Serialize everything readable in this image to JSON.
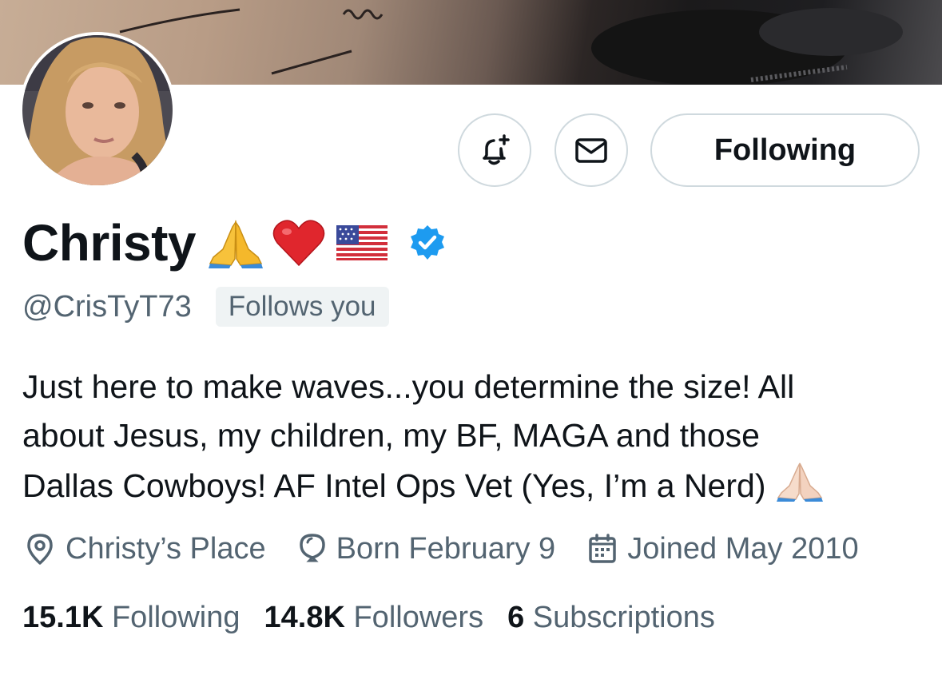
{
  "profile": {
    "name": "Christy",
    "name_emojis": [
      "praying-hands",
      "red-heart",
      "us-flag"
    ],
    "handle": "@CrisTyT73",
    "follows_you_label": "Follows you",
    "verified": true
  },
  "actions": {
    "following_label": "Following"
  },
  "bio": {
    "lines": [
      "Just here to make waves...you determine the size! All",
      "about Jesus, my children, my BF, MAGA and those",
      "Dallas Cowboys! AF Intel Ops Vet (Yes, I’m a Nerd)"
    ]
  },
  "meta": {
    "location": "Christy’s Place",
    "birthday": "Born February 9",
    "joined": "Joined May 2010"
  },
  "stats": {
    "following_count": "15.1K",
    "following_label": "Following",
    "followers_count": "14.8K",
    "followers_label": "Followers",
    "subscriptions_count": "6",
    "subscriptions_label": "Subscriptions"
  },
  "colors": {
    "text_primary": "#0f1419",
    "text_secondary": "#536471",
    "border": "#cfd9de",
    "verified_blue": "#1d9bf0",
    "badge_bg": "#eff3f4"
  }
}
